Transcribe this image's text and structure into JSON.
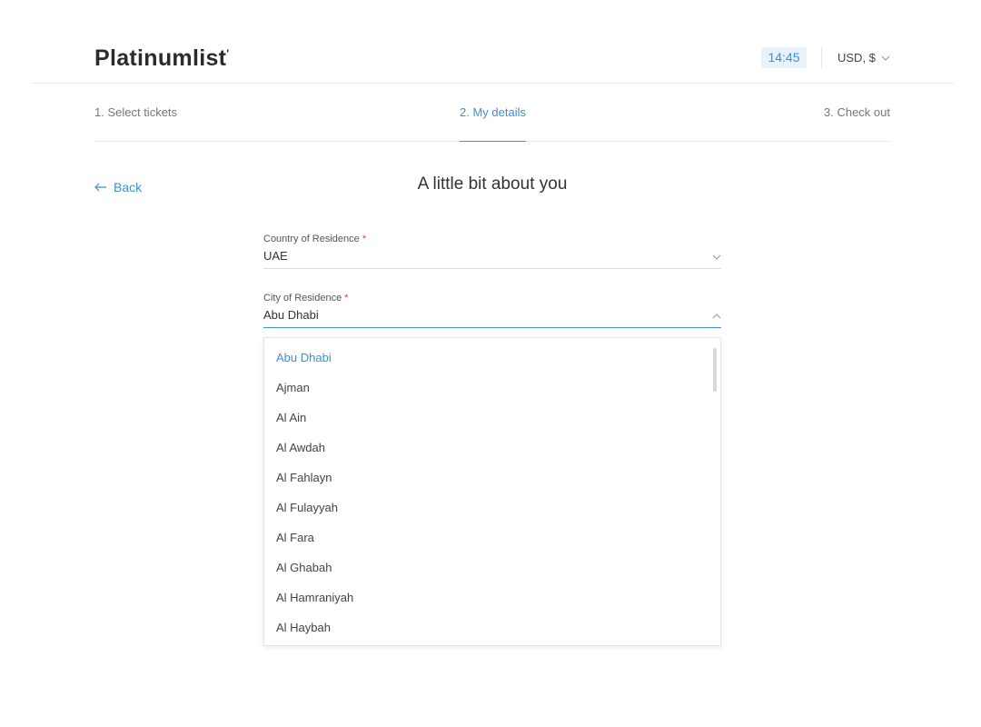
{
  "header": {
    "logo": "Platinumlist",
    "logo_tick": "'",
    "timer": "14:45",
    "currency": "USD, $"
  },
  "steps": [
    {
      "label": "1. Select tickets"
    },
    {
      "label": "2. My details"
    },
    {
      "label": "3. Check out"
    }
  ],
  "back_label": "Back",
  "page_title": "A little bit about you",
  "form": {
    "country": {
      "label": "Country of Residence",
      "required": "*",
      "value": "UAE"
    },
    "city": {
      "label": "City of Residence",
      "required": "*",
      "value": "Abu Dhabi"
    }
  },
  "city_options": [
    "Abu Dhabi",
    "Ajman",
    "Al Ain",
    "Al Awdah",
    "Al Fahlayn",
    "Al Fulayyah",
    "Al Fara",
    "Al Ghabah",
    "Al Hamraniyah",
    "Al Haybah"
  ],
  "colors": {
    "accent": "#3d8fd6",
    "timer_bg": "#e8f2fb",
    "required": "#e23b3b"
  }
}
